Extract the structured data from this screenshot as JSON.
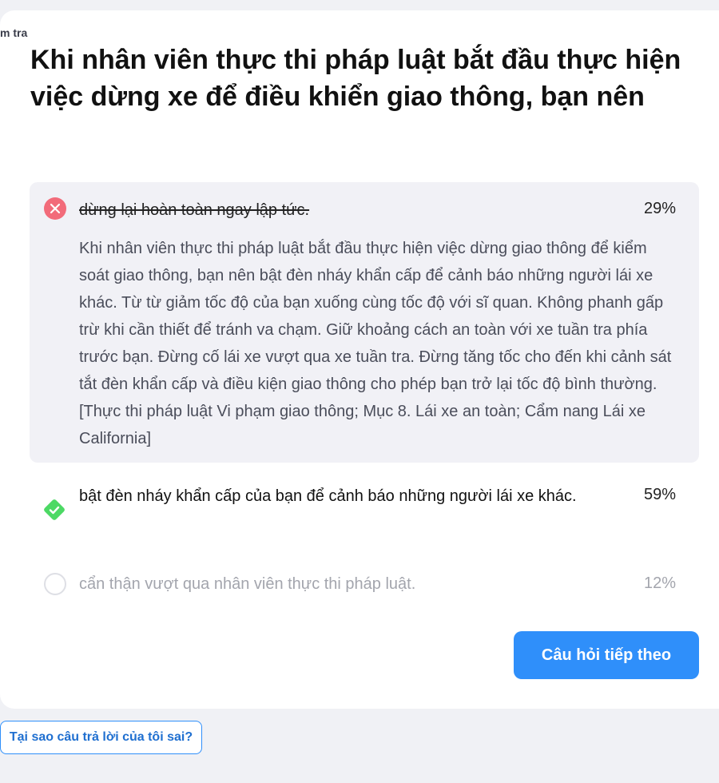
{
  "breadcrumb": "m tra",
  "question": "Khi nhân viên thực thi pháp luật bắt đầu thực hiện việc dừng xe để điều khiển giao thông, bạn nên",
  "answers": [
    {
      "text": "dừng lại hoàn toàn ngay lập tức.",
      "percent": "29%",
      "status": "wrong",
      "explanation": "Khi nhân viên thực thi pháp luật bắt đầu thực hiện việc dừng giao thông để kiểm soát giao thông, bạn nên bật đèn nháy khẩn cấp để cảnh báo những người lái xe khác. Từ từ giảm tốc độ của bạn xuống cùng tốc độ với sĩ quan. Không phanh gấp trừ khi cần thiết để tránh va chạm. Giữ khoảng cách an toàn với xe tuần tra phía trước bạn. Đừng cố lái xe vượt qua xe tuần tra. Đừng tăng tốc cho đến khi cảnh sát tắt đèn khẩn cấp và điều kiện giao thông cho phép bạn trở lại tốc độ bình thường. [Thực thi pháp luật Vi phạm giao thông; Mục 8. Lái xe an toàn; Cẩm nang Lái xe California]"
    },
    {
      "text": "bật đèn nháy khẩn cấp của bạn để cảnh báo những người lái xe khác.",
      "percent": "59%",
      "status": "correct"
    },
    {
      "text": "cẩn thận vượt qua nhân viên thực thi pháp luật.",
      "percent": "12%",
      "status": "neutral"
    }
  ],
  "buttons": {
    "next": "Câu hỏi tiếp theo",
    "why_wrong": "Tại sao câu trả lời của tôi sai?"
  },
  "icons": {
    "wrong": "x-circle-icon",
    "correct": "check-diamond-icon",
    "unselected": "empty-circle-icon"
  },
  "colors": {
    "accent": "#2f8ffa",
    "wrong": "#f26b7a",
    "correct": "#4cd964"
  }
}
